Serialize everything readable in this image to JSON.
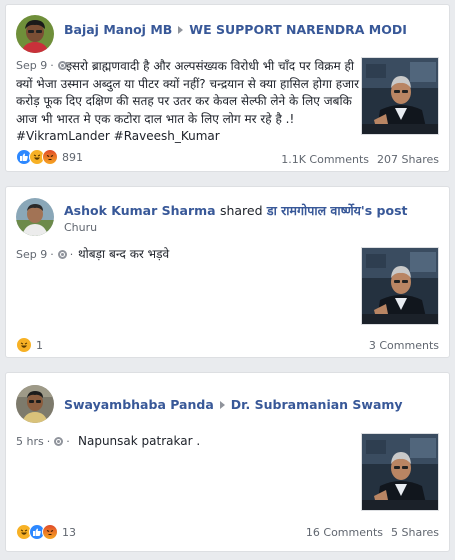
{
  "posts": [
    {
      "author": "Bajaj Manoj MB",
      "target": "WE SUPPORT NARENDRA MODI",
      "time": "Sep 9",
      "text": "इसरो ब्राह्मणवादी है और अल्पसंख्यक विरोधी भी चाँद पर विक्रम ही क्यों भेजा उस्मान अब्दुल या पीटर क्यों नहीं? चन्द्रयान से क्या हासिल होगा हजार करोड़ फूक दिए दक्षिण की सतह पर उतर कर केवल सेल्फी लेने के लिए जबकि आज भी भारत मे एक कटोरा दाल भात के लिए लोग मर रहे है .! #VikramLander #Raveesh_Kumar",
      "reactions": [
        "like-icon",
        "haha-icon",
        "angry-icon"
      ],
      "reaction_count": "891",
      "comments": "1.1K Comments",
      "shares": "207 Shares"
    },
    {
      "author": "Ashok Kumar Sharma",
      "shared_word": "shared",
      "target": "डा रामगोपाल वार्ष्णेय's post",
      "location": "Churu",
      "time": "Sep 9",
      "text": "थोबड़ा बन्द कर भड़वे",
      "reactions": [
        "haha-icon"
      ],
      "reaction_count": "1",
      "comments": "3 Comments"
    },
    {
      "author": "Swayambhaba Panda",
      "target": "Dr. Subramanian Swamy",
      "time": "5 hrs",
      "text": "Napunsak patrakar .",
      "reactions": [
        "haha-icon",
        "like-icon",
        "angry-icon"
      ],
      "reaction_count": "13",
      "comments": "16 Comments",
      "shares": "5 Shares"
    }
  ],
  "colors": {
    "link": "#385898",
    "meta": "#616770",
    "background": "#e9ebee",
    "like": "#2d88ff",
    "haha": "#f7b125"
  }
}
